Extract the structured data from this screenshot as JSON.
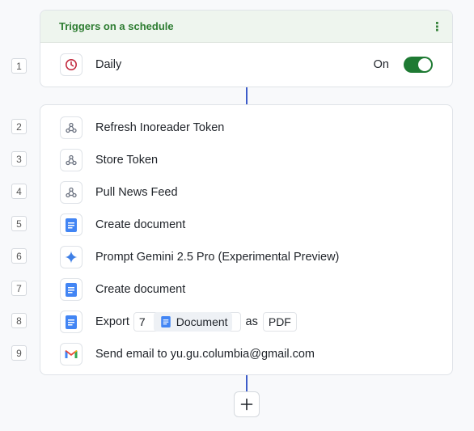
{
  "trigger": {
    "title": "Triggers on a schedule",
    "menu_icon": "⋮",
    "step_number": "1",
    "label": "Daily",
    "toggle_label": "On",
    "enabled": true,
    "icon": "clock-icon"
  },
  "steps": [
    {
      "number": "2",
      "label": "Refresh Inoreader Token",
      "icon": "webhook-icon"
    },
    {
      "number": "3",
      "label": "Store Token",
      "icon": "webhook-icon"
    },
    {
      "number": "4",
      "label": "Pull News Feed",
      "icon": "webhook-icon"
    },
    {
      "number": "5",
      "label": "Create document",
      "icon": "google-docs-icon"
    },
    {
      "number": "6",
      "label": "Prompt Gemini 2.5 Pro (Experimental Preview)",
      "icon": "gemini-icon"
    },
    {
      "number": "7",
      "label": "Create document",
      "icon": "google-docs-icon"
    },
    {
      "number": "8",
      "icon": "google-docs-icon",
      "export": {
        "prefix": "Export",
        "ref_number": "7",
        "ref_label": "Document",
        "middle": "as",
        "format": "PDF"
      }
    },
    {
      "number": "9",
      "label": "Send email to yu.gu.columbia@gmail.com",
      "icon": "gmail-icon"
    }
  ],
  "colors": {
    "accent_green": "#2e7d32",
    "connector_blue": "#3d5cc9",
    "docs_blue": "#4285f4"
  }
}
